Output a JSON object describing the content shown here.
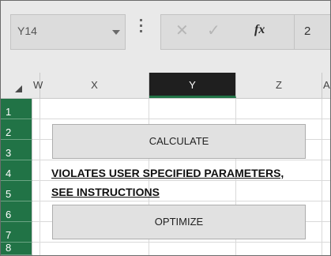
{
  "name_box": {
    "value": "Y14"
  },
  "formula_bar": {
    "fx_label": "fx",
    "value": "2"
  },
  "columns": [
    "W",
    "X",
    "Y",
    "Z",
    "A"
  ],
  "selected_column": "Y",
  "rows": [
    "1",
    "2",
    "3",
    "4",
    "5",
    "6",
    "7",
    "8"
  ],
  "buttons": {
    "calculate": "CALCULATE",
    "optimize": "OPTIMIZE"
  },
  "warning": {
    "line1": "VIOLATES USER SPECIFIED PARAMETERS,",
    "line2": "SEE INSTRUCTIONS"
  },
  "colors": {
    "row_header_green": "#217346",
    "selected_header_bg": "#1f1f1f"
  },
  "icons": [
    "dropdown-arrow-icon",
    "more-options-icon",
    "cancel-icon",
    "enter-icon",
    "insert-function-icon",
    "select-all-icon"
  ]
}
